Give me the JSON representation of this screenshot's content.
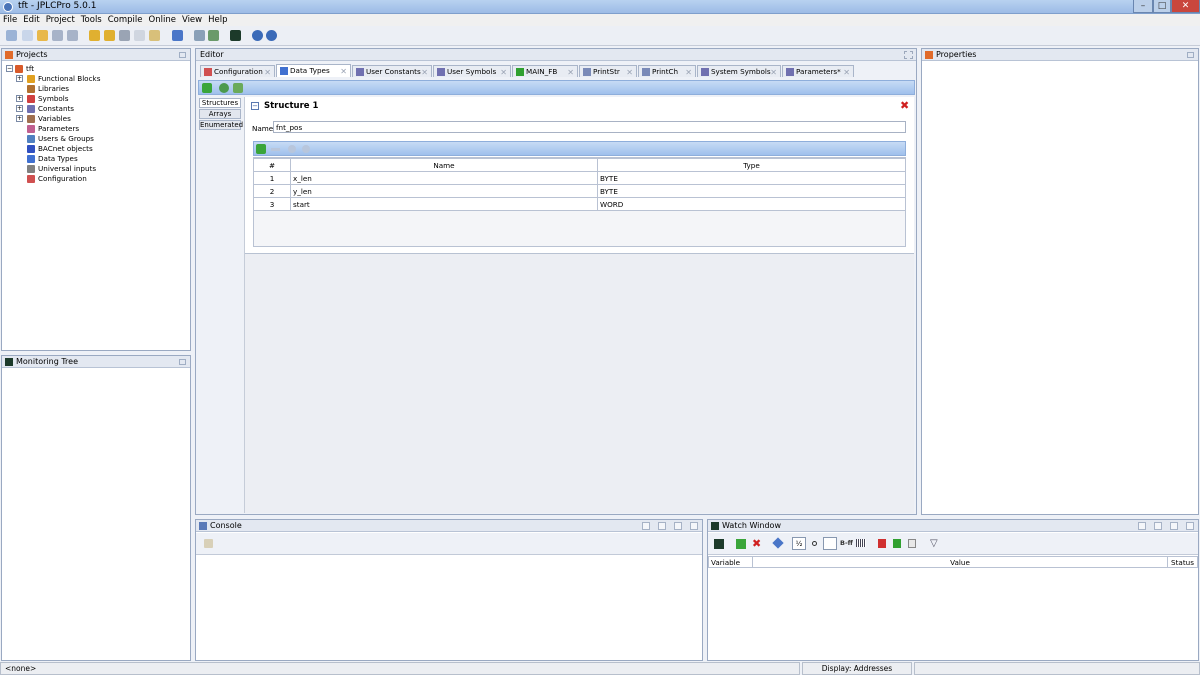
{
  "window": {
    "title": "tft - JPLCPro 5.0.1"
  },
  "menu": [
    "File",
    "Edit",
    "Project",
    "Tools",
    "Compile",
    "Online",
    "View",
    "Help"
  ],
  "projects": {
    "title": "Projects",
    "root": "tft",
    "items": [
      {
        "label": "Functional Blocks",
        "expandable": true,
        "icon": "function-blocks-icon",
        "color": "#e0a020"
      },
      {
        "label": "Libraries",
        "expandable": false,
        "icon": "library-icon",
        "color": "#b07030"
      },
      {
        "label": "Symbols",
        "expandable": true,
        "icon": "symbols-icon",
        "color": "#d04040"
      },
      {
        "label": "Constants",
        "expandable": true,
        "icon": "constants-icon",
        "color": "#7070b0"
      },
      {
        "label": "Variables",
        "expandable": true,
        "icon": "variables-icon",
        "color": "#a07050"
      },
      {
        "label": "Parameters",
        "expandable": false,
        "icon": "parameters-icon",
        "color": "#c06090"
      },
      {
        "label": "Users & Groups",
        "expandable": false,
        "icon": "users-icon",
        "color": "#5080c0"
      },
      {
        "label": "BACnet objects",
        "expandable": false,
        "icon": "bacnet-icon",
        "color": "#3050c0"
      },
      {
        "label": "Data Types",
        "expandable": false,
        "icon": "datatypes-icon",
        "color": "#4070d0"
      },
      {
        "label": "Universal inputs",
        "expandable": false,
        "icon": "universal-inputs-icon",
        "color": "#808080"
      },
      {
        "label": "Configuration",
        "expandable": false,
        "icon": "configuration-icon",
        "color": "#d05050"
      }
    ]
  },
  "monitoring": {
    "title": "Monitoring Tree"
  },
  "editor": {
    "title": "Editor",
    "tabs": [
      {
        "label": "Configuration",
        "active": false
      },
      {
        "label": "Data Types",
        "active": true
      },
      {
        "label": "User Constants",
        "active": false
      },
      {
        "label": "User Symbols",
        "active": false
      },
      {
        "label": "MAIN_FB",
        "active": false
      },
      {
        "label": "PrintStr",
        "active": false
      },
      {
        "label": "PrintCh",
        "active": false
      },
      {
        "label": "System Symbols",
        "active": false
      },
      {
        "label": "Parameters*",
        "active": false
      }
    ],
    "side_buttons": [
      "Structures",
      "Arrays",
      "Enumerated"
    ],
    "structure": {
      "title": "Structure 1",
      "name_label": "Name:",
      "name_value": "fnt_pos",
      "columns": [
        "#",
        "Name",
        "Type"
      ],
      "rows": [
        {
          "n": "1",
          "name": "x_len",
          "type": "BYTE"
        },
        {
          "n": "2",
          "name": "y_len",
          "type": "BYTE"
        },
        {
          "n": "3",
          "name": "start",
          "type": "WORD"
        }
      ]
    }
  },
  "properties": {
    "title": "Properties"
  },
  "console": {
    "title": "Console"
  },
  "watch": {
    "title": "Watch Window",
    "columns": [
      "Variable",
      "Value",
      "Status"
    ],
    "toolbar_text": "B-ff"
  },
  "statusbar": {
    "left": "<none>",
    "display": "Display: Addresses"
  },
  "colors": {
    "accent": "#9bbbe8",
    "close_red": "#d02020",
    "add_green": "#3aa53a"
  }
}
